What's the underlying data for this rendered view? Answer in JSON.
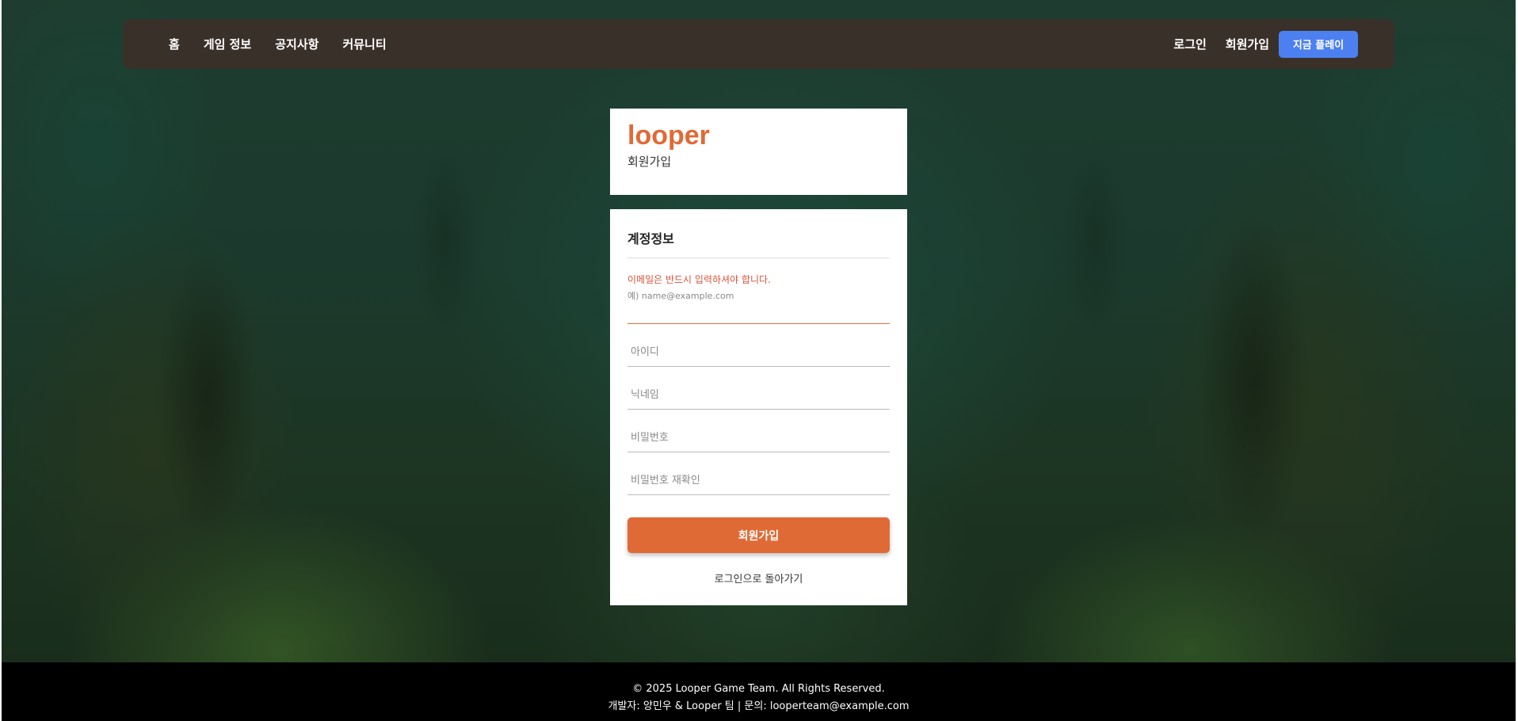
{
  "nav": {
    "left_links": [
      "홈",
      "게임 정보",
      "공지사항",
      "커뮤니티"
    ],
    "login": "로그인",
    "signup": "회원가입",
    "play_now": "지금 플레이"
  },
  "brand": {
    "name": "looper",
    "subtitle": "회원가입"
  },
  "form": {
    "section_title": "계정정보",
    "email_error": "이메일은 반드시 입력하셔야 합니다.",
    "email_hint": "예) name@example.com",
    "email_value": "",
    "id_placeholder": "아이디",
    "nickname_placeholder": "닉네임",
    "password_placeholder": "비밀번호",
    "password_confirm_placeholder": "비밀번호 재확인",
    "submit_label": "회원가입",
    "back_label": "로그인으로 돌아가기"
  },
  "footer": {
    "copyright": "© 2025 Looper Game Team. All Rights Reserved.",
    "credits": "개발자: 양민우 & Looper 팀 | 문의: looperteam@example.com"
  },
  "colors": {
    "accent": "#e06a36",
    "play_button": "#4c80f0",
    "nav_bg": "#3a302a",
    "error": "#d9533a"
  }
}
